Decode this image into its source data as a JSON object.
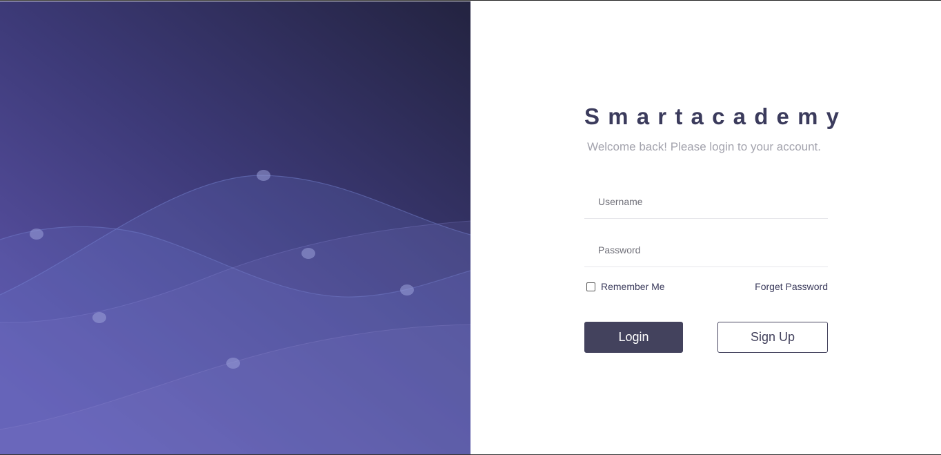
{
  "brand": {
    "name": "Smartacademy",
    "subtitle": "Welcome back! Please login to your account."
  },
  "form": {
    "username": {
      "placeholder": "Username",
      "value": ""
    },
    "password": {
      "placeholder": "Password",
      "value": ""
    },
    "remember_label": "Remember Me",
    "remember_checked": false,
    "forget_label": "Forget Password",
    "login_label": "Login",
    "signup_label": "Sign Up"
  },
  "colors": {
    "accent": "#43425d",
    "hero_top": "#252542",
    "hero_bottom": "#5b52a8"
  }
}
